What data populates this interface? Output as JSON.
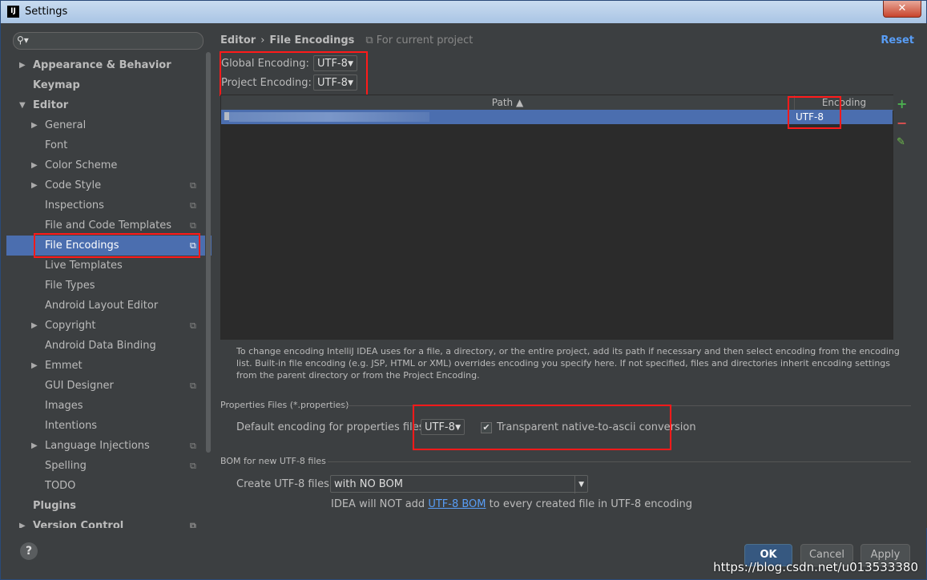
{
  "window": {
    "title": "Settings",
    "close_label": "✕",
    "app_icon": "IJ"
  },
  "search": {
    "placeholder": ""
  },
  "sidebar": {
    "items": [
      {
        "label": "Appearance & Behavior",
        "level": 0,
        "arrow": "▶",
        "bold": true
      },
      {
        "label": "Keymap",
        "level": 0,
        "arrow": "",
        "bold": true
      },
      {
        "label": "Editor",
        "level": 0,
        "arrow": "▼",
        "bold": true
      },
      {
        "label": "General",
        "level": 1,
        "arrow": "▶"
      },
      {
        "label": "Font",
        "level": 1,
        "arrow": ""
      },
      {
        "label": "Color Scheme",
        "level": 1,
        "arrow": "▶"
      },
      {
        "label": "Code Style",
        "level": 1,
        "arrow": "▶",
        "project": true
      },
      {
        "label": "Inspections",
        "level": 1,
        "arrow": "",
        "project": true
      },
      {
        "label": "File and Code Templates",
        "level": 1,
        "arrow": "",
        "project": true
      },
      {
        "label": "File Encodings",
        "level": 1,
        "arrow": "",
        "project": true,
        "selected": true
      },
      {
        "label": "Live Templates",
        "level": 1,
        "arrow": ""
      },
      {
        "label": "File Types",
        "level": 1,
        "arrow": ""
      },
      {
        "label": "Android Layout Editor",
        "level": 1,
        "arrow": ""
      },
      {
        "label": "Copyright",
        "level": 1,
        "arrow": "▶",
        "project": true
      },
      {
        "label": "Android Data Binding",
        "level": 1,
        "arrow": ""
      },
      {
        "label": "Emmet",
        "level": 1,
        "arrow": "▶"
      },
      {
        "label": "GUI Designer",
        "level": 1,
        "arrow": "",
        "project": true
      },
      {
        "label": "Images",
        "level": 1,
        "arrow": ""
      },
      {
        "label": "Intentions",
        "level": 1,
        "arrow": ""
      },
      {
        "label": "Language Injections",
        "level": 1,
        "arrow": "▶",
        "project": true
      },
      {
        "label": "Spelling",
        "level": 1,
        "arrow": "",
        "project": true
      },
      {
        "label": "TODO",
        "level": 1,
        "arrow": ""
      },
      {
        "label": "Plugins",
        "level": 0,
        "arrow": "",
        "bold": true
      },
      {
        "label": "Version Control",
        "level": 0,
        "arrow": "▶",
        "bold": true,
        "project": true
      }
    ]
  },
  "main": {
    "breadcrumb": {
      "root": "Editor",
      "separator": "›",
      "current": "File Encodings",
      "note": "For current project"
    },
    "reset_label": "Reset",
    "global_encoding": {
      "label": "Global Encoding:",
      "value": "UTF-8"
    },
    "project_encoding": {
      "label": "Project Encoding:",
      "value": "UTF-8"
    },
    "table": {
      "columns": [
        "Path ▲",
        "Encoding"
      ],
      "rows": [
        {
          "path": "",
          "encoding": "UTF-8"
        }
      ]
    },
    "tools": {
      "add": "+",
      "remove": "−",
      "edit": "✎"
    },
    "info_text": "To change encoding IntelliJ IDEA uses for a file, a directory, or the entire project, add its path if necessary and then select encoding from the encoding list. Built-in file encoding (e.g. JSP, HTML or XML) overrides encoding you specify here. If not specified, files and directories inherit encoding settings from the parent directory or from the Project Encoding.",
    "properties": {
      "section_title": "Properties Files (*.properties)",
      "default_label": "Default encoding for properties files:",
      "default_value": "UTF-8",
      "checkbox_label": "Transparent native-to-ascii conversion",
      "checked": true
    },
    "bom": {
      "section_title": "BOM for new UTF-8 files",
      "create_label": "Create UTF-8 files:",
      "create_value": "with NO BOM",
      "note_prefix": "IDEA will NOT add",
      "note_link": "UTF-8 BOM",
      "note_suffix": "to every created file in UTF-8 encoding"
    }
  },
  "buttons": {
    "ok": "OK",
    "cancel": "Cancel",
    "apply": "Apply",
    "help": "?"
  },
  "watermark": "https://blog.csdn.net/u013533380",
  "colors": {
    "selection": "#4b6eaf",
    "highlight_box": "#ff1a1a",
    "link": "#589df6"
  }
}
